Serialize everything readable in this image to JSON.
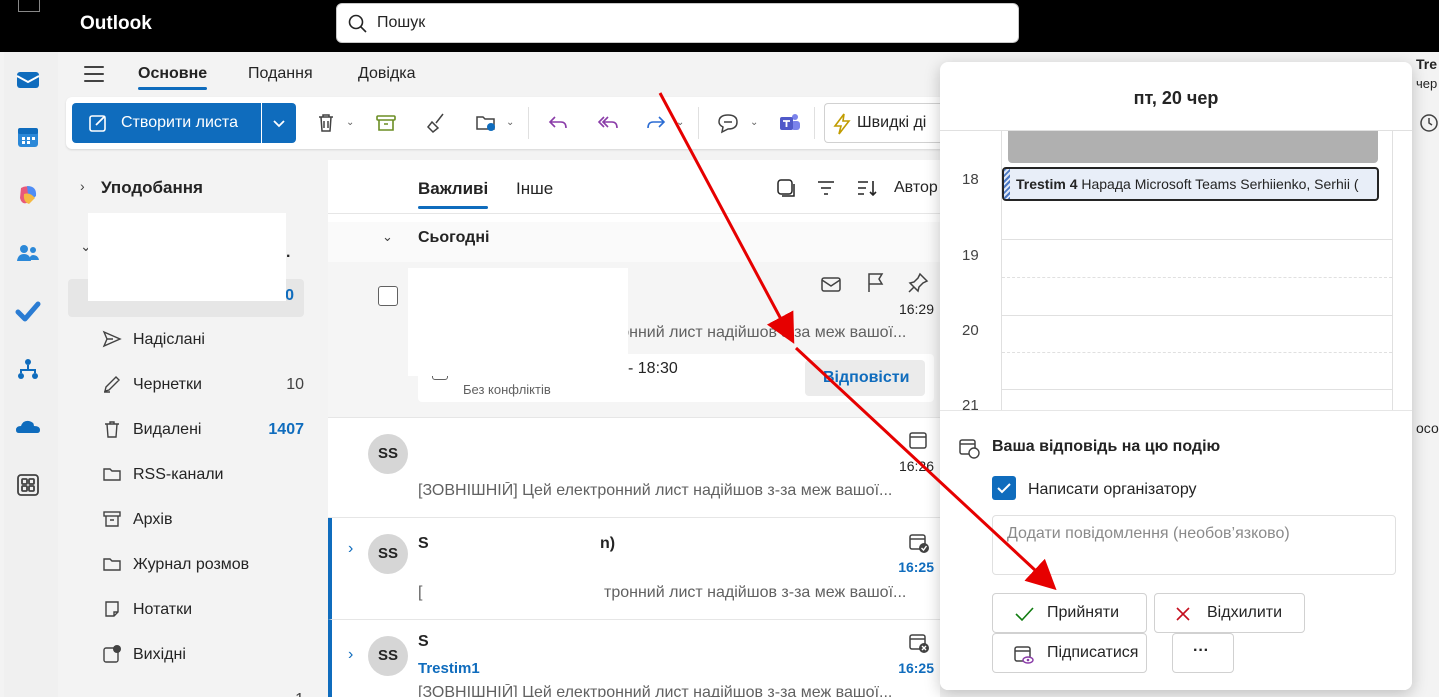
{
  "app": {
    "brand": "Outlook"
  },
  "search": {
    "placeholder": "Пошук"
  },
  "ribbon": {
    "tabs": [
      {
        "label": "Основне",
        "active": true
      },
      {
        "label": "Подання",
        "active": false
      },
      {
        "label": "Довідка",
        "active": false
      }
    ],
    "new_mail_label": "Створити листа",
    "quick_steps_label": "Швидкі ді"
  },
  "folders": {
    "favorites_label": "Уподобання",
    "items": [
      {
        "label": "Надіслані",
        "count": "",
        "icon": "send-icon"
      },
      {
        "label": "Чернетки",
        "count": "10",
        "icon": "pencil-icon"
      },
      {
        "label": "Видалені",
        "count": "1407",
        "icon": "trash-icon"
      },
      {
        "label": "RSS-канали",
        "count": "",
        "icon": "folder-icon"
      },
      {
        "label": "Архів",
        "count": "",
        "icon": "archive-icon"
      },
      {
        "label": "Журнал розмов",
        "count": "",
        "icon": "folder-icon"
      },
      {
        "label": "Нотатки",
        "count": "",
        "icon": "note-icon"
      },
      {
        "label": "Вихідні",
        "count": "",
        "icon": "outbox-icon"
      }
    ],
    "inbox_count_partial": "0",
    "account_dots": ".",
    "last_partial_count": "1"
  },
  "message_list": {
    "tabs": [
      {
        "label": "Важливі"
      },
      {
        "label": "Інше"
      }
    ],
    "sort_label": "Автор",
    "group_label": "Сьогодні",
    "messages": [
      {
        "avatar": "",
        "time": "16:29",
        "preview": "тронний лист надійшов з-за меж вашої...",
        "event_time": "- 18:30",
        "event_status": "Без конфліктів",
        "reply_label": "Відповісти"
      },
      {
        "avatar": "SS",
        "time": "16:26",
        "preview": "[ЗОВНІШНІЙ] Цей електронний лист надійшов з-за меж вашої..."
      },
      {
        "avatar": "SS",
        "sender_start": "S",
        "sender_end": "n)",
        "time": "16:25",
        "preview_start": "[",
        "preview": "тронний лист надійшов з-за меж вашої..."
      },
      {
        "avatar": "SS",
        "sender_start": "S",
        "subject": "Trestim1",
        "time": "16:25",
        "preview": "[ЗОВНІШНІЙ] Цей електронний лист надійшов з-за меж вашої..."
      }
    ]
  },
  "calendar_popup": {
    "date": "пт, 20 чер",
    "hours": [
      "18",
      "19",
      "20",
      "21"
    ],
    "event_title": "Trestim 4",
    "event_rest": "Нарада Microsoft Teams Serhiienko, Serhii (",
    "response_title": "Ваша відповідь на цю подію",
    "notify_label": "Написати організатору",
    "notify_checked": true,
    "message_placeholder": "Додати повідомлення (необов’язково)",
    "accept_label": "Прийняти",
    "decline_label": "Відхилити",
    "subscribe_label": "Підписатися",
    "more_label": "···"
  },
  "edge": {
    "top1": "Tre",
    "top2": "чер",
    "mid": "осов"
  },
  "colors": {
    "accent": "#0f6cbd",
    "arrow": "#e60000"
  }
}
